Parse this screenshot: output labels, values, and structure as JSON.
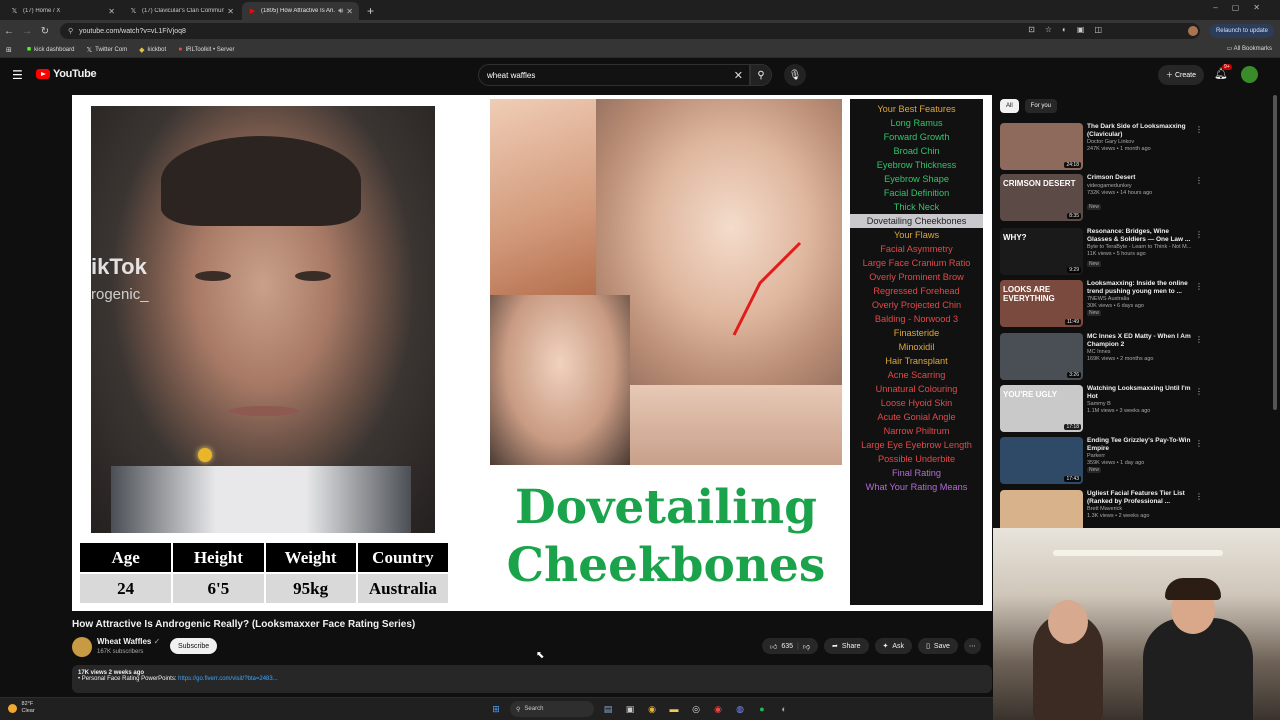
{
  "browser": {
    "tabs": [
      {
        "label": "(17) Home / X",
        "icon": "x-logo-icon"
      },
      {
        "label": "(17) Clavicular's Clan Communi...",
        "icon": "x-logo-icon"
      },
      {
        "label": "(1805) How Attractive Is An...",
        "icon": "youtube-icon",
        "active": true
      }
    ],
    "url": "youtube.com/watch?v=vL1FiVjoq8",
    "relaunch_label": "Relaunch to update",
    "bookmarks": [
      {
        "label": "kick dashboard",
        "icon": "kick-icon"
      },
      {
        "label": "Twitter Com",
        "icon": "x-logo-icon"
      },
      {
        "label": "kickbot",
        "icon": "bot-icon"
      },
      {
        "label": "IRLToolkit • Server",
        "icon": "irl-icon"
      }
    ],
    "all_bookmarks_label": "All Bookmarks"
  },
  "youtube": {
    "logo_text": "YouTube",
    "search_value": "wheat waffles",
    "create_label": "Create",
    "notif_count": "9+"
  },
  "video": {
    "watermark_1": "ikTok",
    "watermark_2": "rogenic_",
    "stats": {
      "headers": [
        "Age",
        "Height",
        "Weight",
        "Country"
      ],
      "values": [
        "24",
        "6'5",
        "95kg",
        "Australia"
      ]
    },
    "headline_1": "Dovetailing",
    "headline_2": "Cheekbones",
    "features": [
      {
        "text": "Your Best Features",
        "kind": "hdr"
      },
      {
        "text": "Long Ramus",
        "kind": "good"
      },
      {
        "text": "Forward Growth",
        "kind": "good"
      },
      {
        "text": "Broad Chin",
        "kind": "good"
      },
      {
        "text": "Eyebrow Thickness",
        "kind": "good"
      },
      {
        "text": "Eyebrow Shape",
        "kind": "good"
      },
      {
        "text": "Facial Definition",
        "kind": "good"
      },
      {
        "text": "Thick Neck",
        "kind": "good"
      },
      {
        "text": "Dovetailing Cheekbones",
        "kind": "sel"
      },
      {
        "text": "Your Flaws",
        "kind": "hdr"
      },
      {
        "text": "Facial Asymmetry",
        "kind": "bad"
      },
      {
        "text": "Large Face Cranium Ratio",
        "kind": "bad"
      },
      {
        "text": "Overly Prominent Brow",
        "kind": "bad"
      },
      {
        "text": "Regressed Forehead",
        "kind": "bad"
      },
      {
        "text": "Overly Projected Chin",
        "kind": "bad"
      },
      {
        "text": "Balding - Norwood 3",
        "kind": "bad"
      },
      {
        "text": "Finasteride",
        "kind": "hdr"
      },
      {
        "text": "Minoxidil",
        "kind": "hdr"
      },
      {
        "text": "Hair Transplant",
        "kind": "hdr"
      },
      {
        "text": "Acne Scarring",
        "kind": "bad"
      },
      {
        "text": "Unnatural Colouring",
        "kind": "bad"
      },
      {
        "text": "Loose Hyoid Skin",
        "kind": "bad"
      },
      {
        "text": "Acute Gonial Angle",
        "kind": "bad"
      },
      {
        "text": "Narrow Philtrum",
        "kind": "bad"
      },
      {
        "text": "Large Eye Eyebrow Length",
        "kind": "bad"
      },
      {
        "text": "Possible Underbite",
        "kind": "bad"
      },
      {
        "text": "Final Rating",
        "kind": "fin"
      },
      {
        "text": "What Your Rating Means",
        "kind": "fin"
      }
    ],
    "title": "How Attractive Is Androgenic Really? (Looksmaxxer Face Rating Series)",
    "channel": "Wheat Waffles",
    "subs": "167K subscribers",
    "subscribe_label": "Subscribe",
    "likes": "635",
    "share_label": "Share",
    "ask_label": "Ask",
    "save_label": "Save",
    "desc_meta": "17K views  2 weeks ago",
    "desc_line": "Personal Face Rating PowerPoints: ",
    "desc_link": "https://go.fiverr.com/visit/?bta=2483..."
  },
  "sidebar": {
    "chips": [
      "All",
      "For you"
    ],
    "recs": [
      {
        "title": "The Dark Side of Looksmaxxing (Clavicular)",
        "channel": "Doctor Gary Linkov",
        "meta": "247K views • 1 month ago",
        "dur": "24:18",
        "bg": "#8d6a5c",
        "thumb_text": "",
        "new": false
      },
      {
        "title": "Crimson Desert",
        "channel": "videogamedunkey",
        "meta": "732K views • 14 hours ago",
        "dur": "8:35",
        "bg": "#5b4a46",
        "thumb_text": "CRIMSON DESERT",
        "new": true
      },
      {
        "title": "Resonance: Bridges, Wine Glasses & Soldiers — One Law ...",
        "channel": "Byte to TeraByte - Learn to Think - Not M...",
        "meta": "11K views • 5 hours ago",
        "dur": "9:29",
        "bg": "#1a1a1a",
        "thumb_text": "WHY?",
        "new": true
      },
      {
        "title": "Looksmaxxing: Inside the online trend pushing young men to ...",
        "channel": "7NEWS Australia",
        "meta": "30K views • 6 days ago",
        "dur": "11:49",
        "bg": "#7a4a3e",
        "thumb_text": "LOOKS ARE EVERYTHING",
        "new": true
      },
      {
        "title": "MC Innes X ED Matty - When I Am Champion 2",
        "channel": "MC Innes",
        "meta": "169K views • 2 months ago",
        "dur": "3:26",
        "bg": "#4a4f55",
        "thumb_text": "",
        "new": false
      },
      {
        "title": "Watching Looksmaxxing Until I'm Hot",
        "channel": "Sammy B",
        "meta": "1.1M views • 3 weeks ago",
        "dur": "17:18",
        "bg": "#c9c9c9",
        "thumb_text": "YOU'RE UGLY",
        "new": false
      },
      {
        "title": "Ending Tee Grizzley's Pay-To-Win Empire",
        "channel": "Parkerr",
        "meta": "359K views • 1 day ago",
        "dur": "17:43",
        "bg": "#2f4a66",
        "thumb_text": "",
        "new": true
      },
      {
        "title": "Ugliest Facial Features Tier List (Ranked by Professional ...",
        "channel": "Brett Maverick",
        "meta": "1.3K views • 2 weeks ago",
        "dur": "",
        "bg": "#d7b28a",
        "thumb_text": "",
        "new": false
      }
    ]
  },
  "taskbar": {
    "temp": "82°F",
    "cond": "Clear",
    "search_label": "Search"
  },
  "colors": {
    "yt_red": "#ff0000",
    "headline_green": "#1aa34a",
    "good_green": "#32c46a",
    "flaw_red": "#e04a4a",
    "header_orange": "#e0a83b",
    "link_blue": "#3ea6ff"
  }
}
